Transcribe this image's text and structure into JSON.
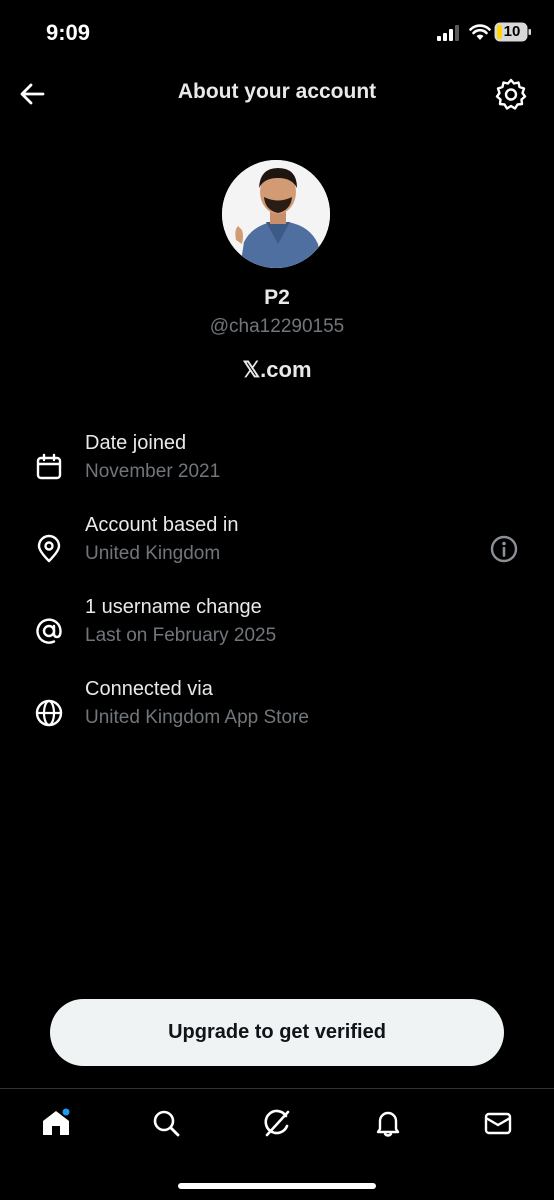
{
  "status_bar": {
    "time": "9:09",
    "battery": "10"
  },
  "header": {
    "title": "About your account"
  },
  "profile": {
    "name": "P2",
    "handle": "@cha12290155",
    "site": "𝕏.com"
  },
  "info_rows": [
    {
      "title": "Date joined",
      "subtitle": "November 2021",
      "icon": "calendar-icon"
    },
    {
      "title": "Account based in",
      "subtitle": "United Kingdom",
      "icon": "location-pin-icon"
    },
    {
      "title": "1 username change",
      "subtitle": "Last on February 2025",
      "icon": "at-sign-icon"
    },
    {
      "title": "Connected via",
      "subtitle": "United Kingdom App Store",
      "icon": "globe-icon"
    }
  ],
  "upgrade_button": {
    "label": "Upgrade to get verified"
  },
  "tabs": [
    "home-icon",
    "search-icon",
    "grok-icon",
    "bell-icon",
    "mail-icon"
  ],
  "colors": {
    "background": "#000000",
    "text": "#e7e9ea",
    "secondary": "#71767b",
    "accent": "#1d9bf0",
    "battery": "#ffd60a"
  }
}
